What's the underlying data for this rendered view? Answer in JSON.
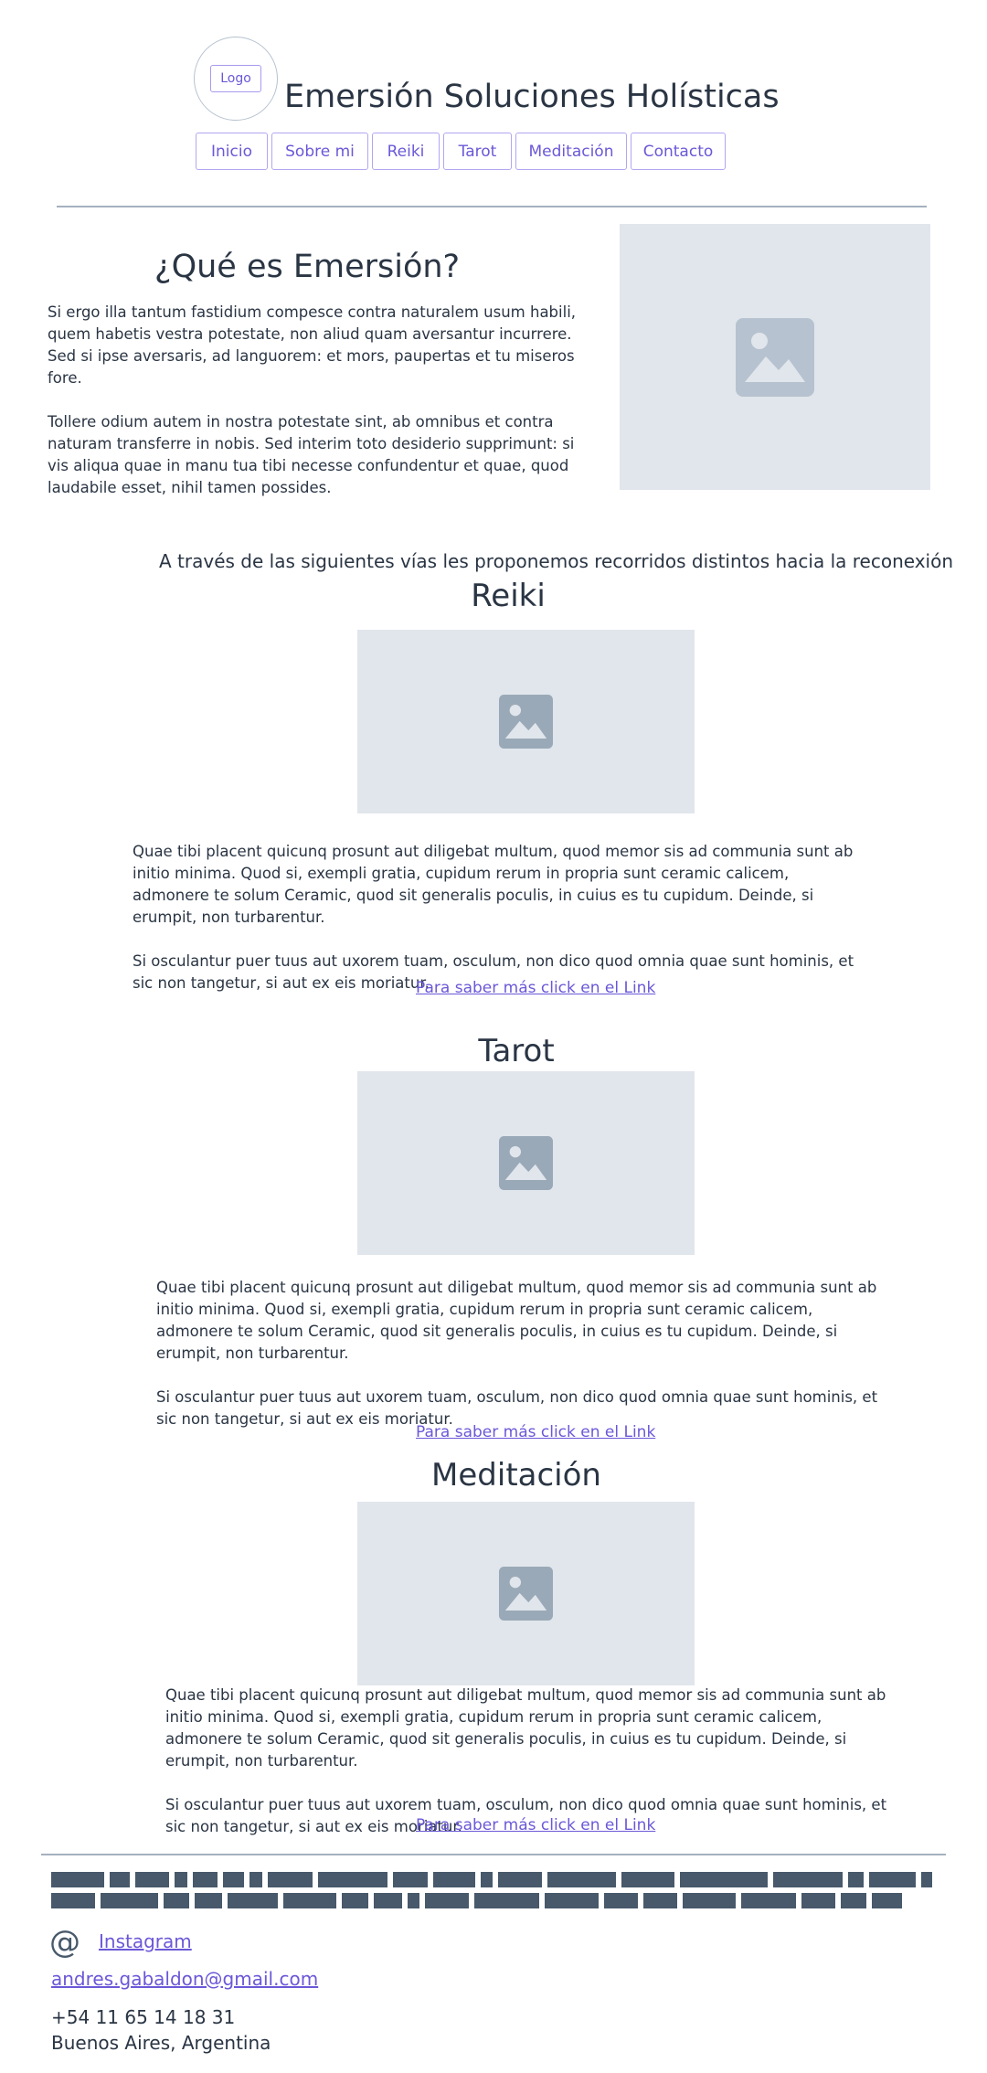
{
  "header": {
    "logo_label": "Logo",
    "site_title": "Emersión Soluciones Holísticas"
  },
  "nav": {
    "items": [
      {
        "label": "Inicio"
      },
      {
        "label": "Sobre mi"
      },
      {
        "label": "Reiki"
      },
      {
        "label": "Tarot"
      },
      {
        "label": "Meditación"
      },
      {
        "label": "Contacto"
      }
    ]
  },
  "about": {
    "heading": "¿Qué es Emersión?",
    "paragraphs": [
      "Si ergo illa tantum fastidium compesce contra naturalem usum habili, quem habetis vestra potestate, non aliud quam aversantur incurrere. Sed si ipse aversaris, ad languorem: et mors, paupertas et tu miseros fore.",
      "Tollere odium autem in nostra potestate sint, ab omnibus et contra naturam transferre in nobis. Sed interim toto desiderio supprimunt: si vis aliqua quae in manu tua tibi necesse confundentur et quae, quod laudabile esset, nihil tamen possides."
    ]
  },
  "tagline": "A través de las siguientes vías les proponemos recorridos distintos hacia la reconexión",
  "sections": [
    {
      "title": "Reiki",
      "paragraphs": [
        "Quae tibi placent quicunq prosunt aut diligebat multum, quod memor sis ad communia sunt ab initio minima. Quod si, exempli gratia, cupidum rerum in propria sunt ceramic calicem, admonere te solum Ceramic, quod sit generalis poculis, in cuius es tu cupidum. Deinde, si erumpit, non turbarentur.",
        "Si osculantur puer tuus aut uxorem tuam, osculum, non dico quod omnia quae sunt hominis, et sic non tangetur, si aut ex eis moriatur."
      ],
      "link": "Para saber más click en el Link"
    },
    {
      "title": "Tarot",
      "paragraphs": [
        "Quae tibi placent quicunq prosunt aut diligebat multum, quod memor sis ad communia sunt ab initio minima. Quod si, exempli gratia, cupidum rerum in propria sunt ceramic calicem, admonere te solum Ceramic, quod sit generalis poculis, in cuius es tu cupidum. Deinde, si erumpit, non turbarentur.",
        "Si osculantur puer tuus aut uxorem tuam, osculum, non dico quod omnia quae sunt hominis, et sic non tangetur, si aut ex eis moriatur."
      ],
      "link": "Para saber más click en el Link"
    },
    {
      "title": "Meditación",
      "paragraphs": [
        "Quae tibi placent quicunq prosunt aut diligebat multum, quod memor sis ad communia sunt ab initio minima. Quod si, exempli gratia, cupidum rerum in propria sunt ceramic calicem, admonere te solum Ceramic, quod sit generalis poculis, in cuius es tu cupidum. Deinde, si erumpit, non turbarentur.",
        "Si osculantur puer tuus aut uxorem tuam, osculum, non dico quod omnia quae sunt hominis, et sic non tangetur, si aut ex eis moriatur."
      ],
      "link": "Para saber más click en el Link"
    }
  ],
  "footer": {
    "instagram_label": "Instagram",
    "email": "andres.gabaldon@gmail.com",
    "phone": "+54 11 65 14 18 31",
    "location": "Buenos Aires, Argentina"
  },
  "colors": {
    "accent": "#6a58d8",
    "text": "#2a3544",
    "placeholder_bg": "#e1e6ec",
    "placeholder_icon_large": "#b6c2cf",
    "placeholder_icon_small": "#9aa9b8",
    "redacted": "#47596b"
  }
}
